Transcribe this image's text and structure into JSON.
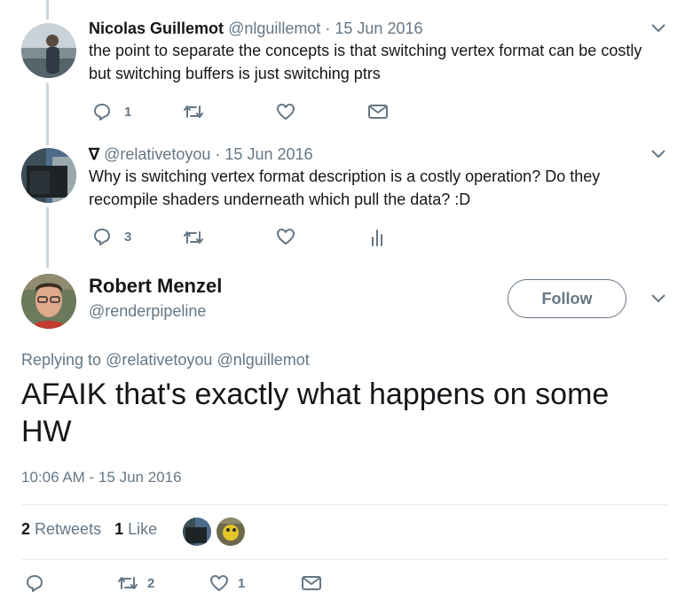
{
  "tweets": [
    {
      "name": "Nicolas Guillemot",
      "handle": "@nlguillemot",
      "date": "· 15 Jun 2016",
      "text": "the point to separate the concepts is that switching vertex format can be costly but switching buffers is just switching ptrs",
      "replies": "1",
      "retweets": "",
      "likes": "",
      "fourth_icon": "mail-icon"
    },
    {
      "name": "∇",
      "handle": "@relativetoyou",
      "date": "· 15 Jun 2016",
      "text": "Why is switching vertex format description is a costly operation? Do they recompile shaders underneath which pull the data? :D",
      "replies": "3",
      "retweets": "",
      "likes": "",
      "fourth_icon": "analytics-icon"
    }
  ],
  "main": {
    "name": "Robert Menzel",
    "handle": "@renderpipeline",
    "follow_label": "Follow",
    "replying_prefix": "Replying to",
    "replying_to_1": "@relativetoyou",
    "replying_to_2": "@nlguillemot",
    "text": "AFAIK that's exactly what happens on some HW",
    "timestamp": "10:06 AM - 15 Jun 2016",
    "retweet_count": "2",
    "retweet_label": "Retweets",
    "like_count": "1",
    "like_label": "Like",
    "action_retweets": "2",
    "action_likes": "1"
  },
  "colors": {
    "text": "#14171a",
    "secondary": "#657786",
    "divider": "#e6ecf0",
    "thread_line": "#ccd6dd"
  }
}
